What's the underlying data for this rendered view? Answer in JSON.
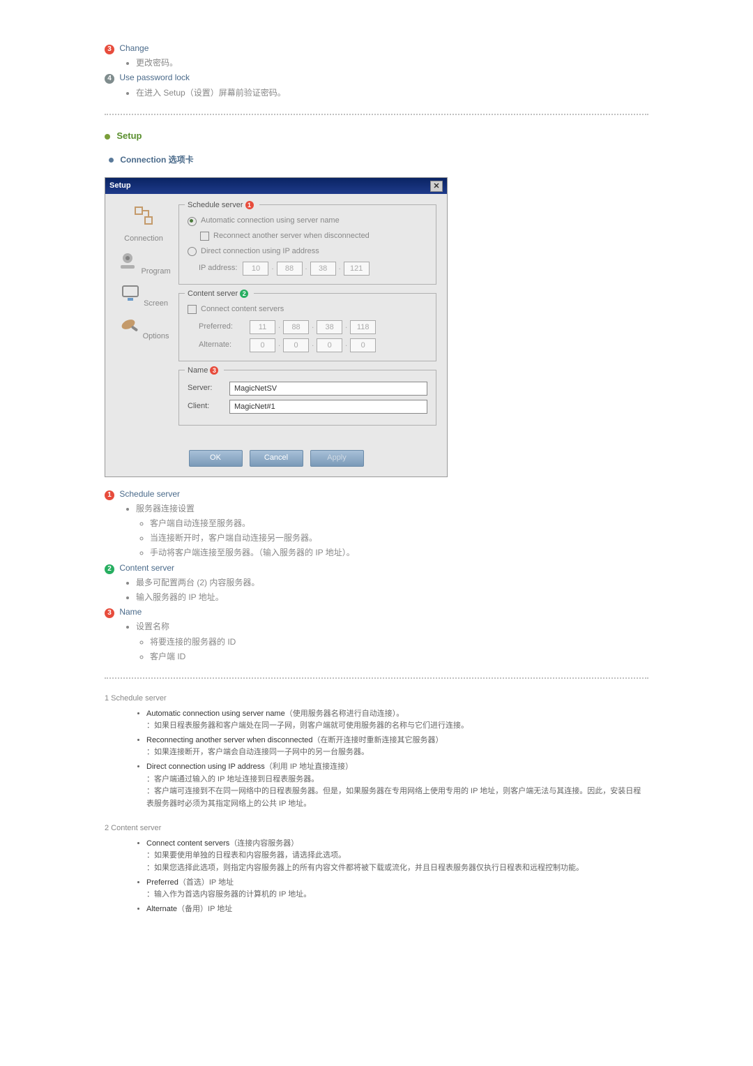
{
  "top": {
    "change_title": "Change",
    "change_bullet": "更改密码。",
    "lock_title": "Use password lock",
    "lock_bullet": "在进入 Setup（设置）屏幕前验证密码。"
  },
  "section": {
    "setup": "Setup",
    "connection_tab": "Connection 选项卡"
  },
  "win": {
    "title": "Setup",
    "sidebar": {
      "connection": "Connection",
      "program": "Program",
      "screen": "Screen",
      "options": "Options"
    },
    "schedule": {
      "legend": "Schedule server",
      "auto": "Automatic connection using server name",
      "reconnect": "Reconnect another server when disconnected",
      "direct": "Direct connection using IP address",
      "ip_label": "IP address:",
      "ip": [
        "10",
        "88",
        "38",
        "121"
      ]
    },
    "content": {
      "legend": "Content server",
      "connect": "Connect content servers",
      "preferred_label": "Preferred:",
      "preferred_ip": [
        "11",
        "88",
        "38",
        "118"
      ],
      "alternate_label": "Alternate:",
      "alternate_ip": [
        "0",
        "0",
        "0",
        "0"
      ]
    },
    "name": {
      "legend": "Name",
      "server_label": "Server:",
      "server_value": "MagicNetSV",
      "client_label": "Client:",
      "client_value": "MagicNet#1"
    },
    "buttons": {
      "ok": "OK",
      "cancel": "Cancel",
      "apply": "Apply"
    }
  },
  "expl": {
    "schedule": {
      "title": "Schedule server",
      "head": "服务器连接设置",
      "a": "客户端自动连接至服务器。",
      "b": "当连接断开时，客户端自动连接另一服务器。",
      "c": "手动将客户端连接至服务器。（输入服务器的 IP 地址）。"
    },
    "content": {
      "title": "Content server",
      "a": "最多可配置两台 (2) 内容服务器。",
      "b": "输入服务器的 IP 地址。"
    },
    "name": {
      "title": "Name",
      "head": "设置名称",
      "a": "将要连接的服务器的 ID",
      "b": "客户端 ID"
    }
  },
  "appendix": {
    "h1": "1   Schedule server",
    "a1_t": "Automatic connection using server name",
    "a1_p": "（使用服务器名称进行自动连接）。",
    "a1_d": "：如果日程表服务器和客户端处在同一子网，则客户端就可使用服务器的名称与它们进行连接。",
    "a2_t": "Reconnecting another server when disconnected",
    "a2_p": "（在断开连接时重新连接其它服务器）",
    "a2_d": "：如果连接断开，客户端会自动连接同一子网中的另一台服务器。",
    "a3_t": "Direct connection using IP address",
    "a3_p": "（利用 IP 地址直接连接）",
    "a3_d1": "：客户端通过输入的 IP 地址连接到日程表服务器。",
    "a3_d2": "：客户端可连接到不在同一网络中的日程表服务器。但是，如果服务器在专用网络上使用专用的 IP 地址，则客户端无法与其连接。因此，安装日程表服务器时必须为其指定网络上的公共 IP 地址。",
    "h2": "2   Content server",
    "b1_t": "Connect content servers",
    "b1_p": "（连接内容服务器）",
    "b1_d1": "：如果要使用单独的日程表和内容服务器，请选择此选项。",
    "b1_d2": "：如果您选择此选项，则指定内容服务器上的所有内容文件都将被下载或流化，并且日程表服务器仅执行日程表和远程控制功能。",
    "b2_t": "Preferred",
    "b2_p": "（首选）IP 地址",
    "b2_d": "：输入作为首选内容服务器的计算机的 IP 地址。",
    "b3_t": "Alternate",
    "b3_p": "（备用）IP 地址"
  }
}
